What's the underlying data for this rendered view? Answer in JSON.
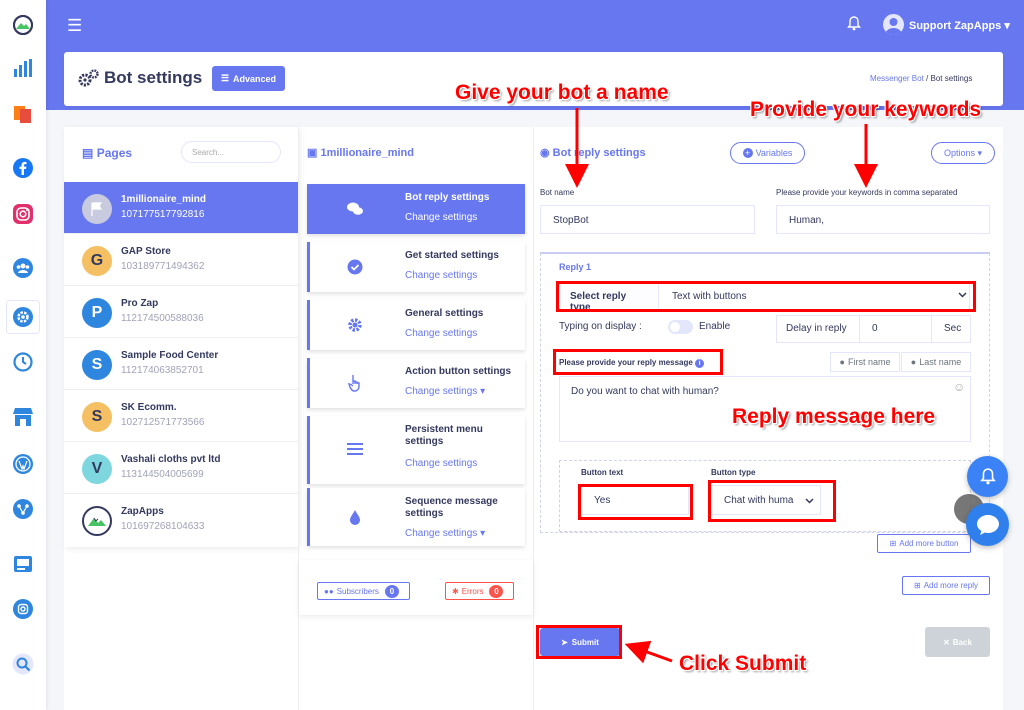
{
  "topbar": {
    "menu_icon": "hamburger-icon",
    "notification_icon": "bell-icon",
    "user_name": "Support ZapApps",
    "accent": "#6777ef"
  },
  "sidebar_icons": [
    "logo-icon",
    "chart-icon",
    "pages-icon",
    "facebook-icon",
    "instagram-icon",
    "users-icon",
    "gear-icon",
    "history-icon",
    "store-icon",
    "wordpress-icon",
    "share-icon",
    "media-icon",
    "instagram-small-icon",
    "search-icon"
  ],
  "header": {
    "title": "Bot settings",
    "advanced_label": "Advanced",
    "breadcrumb": {
      "parent": "Messenger Bot",
      "sep": "/",
      "current": "Bot settings"
    }
  },
  "pages_panel": {
    "title": "Pages",
    "search_placeholder": "Search...",
    "items": [
      {
        "name": "1millionaire_mind",
        "id": "107177517792816",
        "initial": "",
        "color": "#c8cbe0"
      },
      {
        "name": "GAP Store",
        "id": "103189771494362",
        "initial": "G",
        "color": "#f4c063"
      },
      {
        "name": "Pro Zap",
        "id": "112174500588036",
        "initial": "P",
        "color": "#2e86de"
      },
      {
        "name": "Sample Food Center",
        "id": "112174063852701",
        "initial": "S",
        "color": "#2e86de"
      },
      {
        "name": "SK Ecomm.",
        "id": "102712571773566",
        "initial": "S",
        "color": "#f4c063"
      },
      {
        "name": "Vashali cloths pvt ltd",
        "id": "113144504005699",
        "initial": "V",
        "color": "#7ed6df"
      },
      {
        "name": "ZapApps",
        "id": "101697268104633",
        "initial": "",
        "color": "#ffffff"
      }
    ]
  },
  "menu_panel": {
    "title": "1millionaire_mind",
    "items": [
      {
        "title": "Bot reply settings",
        "sub": "Change settings",
        "icon": "comments-icon"
      },
      {
        "title": "Get started settings",
        "sub": "Change settings",
        "icon": "check-circle-icon"
      },
      {
        "title": "General settings",
        "sub": "Change settings",
        "icon": "cog-icon"
      },
      {
        "title": "Action button settings",
        "sub": "Change settings",
        "icon": "hand-pointer-icon"
      },
      {
        "title": "Persistent menu settings",
        "sub": "Change settings",
        "icon": "bars-icon"
      },
      {
        "title": "Sequence message settings",
        "sub": "Change settings",
        "icon": "drop-icon"
      }
    ],
    "subscribers_label": "Subscribers",
    "subscribers_count": "0",
    "errors_label": "Errors",
    "errors_count": "0"
  },
  "form": {
    "title": "Bot reply settings",
    "variables_label": "Variables",
    "options_label": "Options",
    "bot_name_label": "Bot name",
    "bot_name_value": "StopBot",
    "keywords_label": "Please provide your keywords in comma separated",
    "keywords_value": "Human,",
    "reply_label": "Reply 1",
    "select_reply_type_label": "Select reply type",
    "reply_type_value": "Text with buttons",
    "typing_label": "Typing on display :",
    "enable_label": "Enable",
    "delay_label": "Delay in reply",
    "delay_value": "0",
    "delay_unit": "Sec",
    "message_label": "Please provide your reply message",
    "first_name_label": "First name",
    "last_name_label": "Last name",
    "message_value": "Do you want to chat with human?",
    "button_text_label": "Button text",
    "button_text_value": "Yes",
    "button_type_label": "Button type",
    "button_type_value": "Chat with huma",
    "add_more_button_label": "Add more button",
    "add_more_reply_label": "Add more reply",
    "submit_label": "Submit",
    "back_label": "Back"
  },
  "annotations": {
    "name": "Give your bot a name",
    "keywords": "Provide your keywords",
    "reply": "Reply message here",
    "submit": "Click Submit",
    "color": "#ff0000"
  }
}
